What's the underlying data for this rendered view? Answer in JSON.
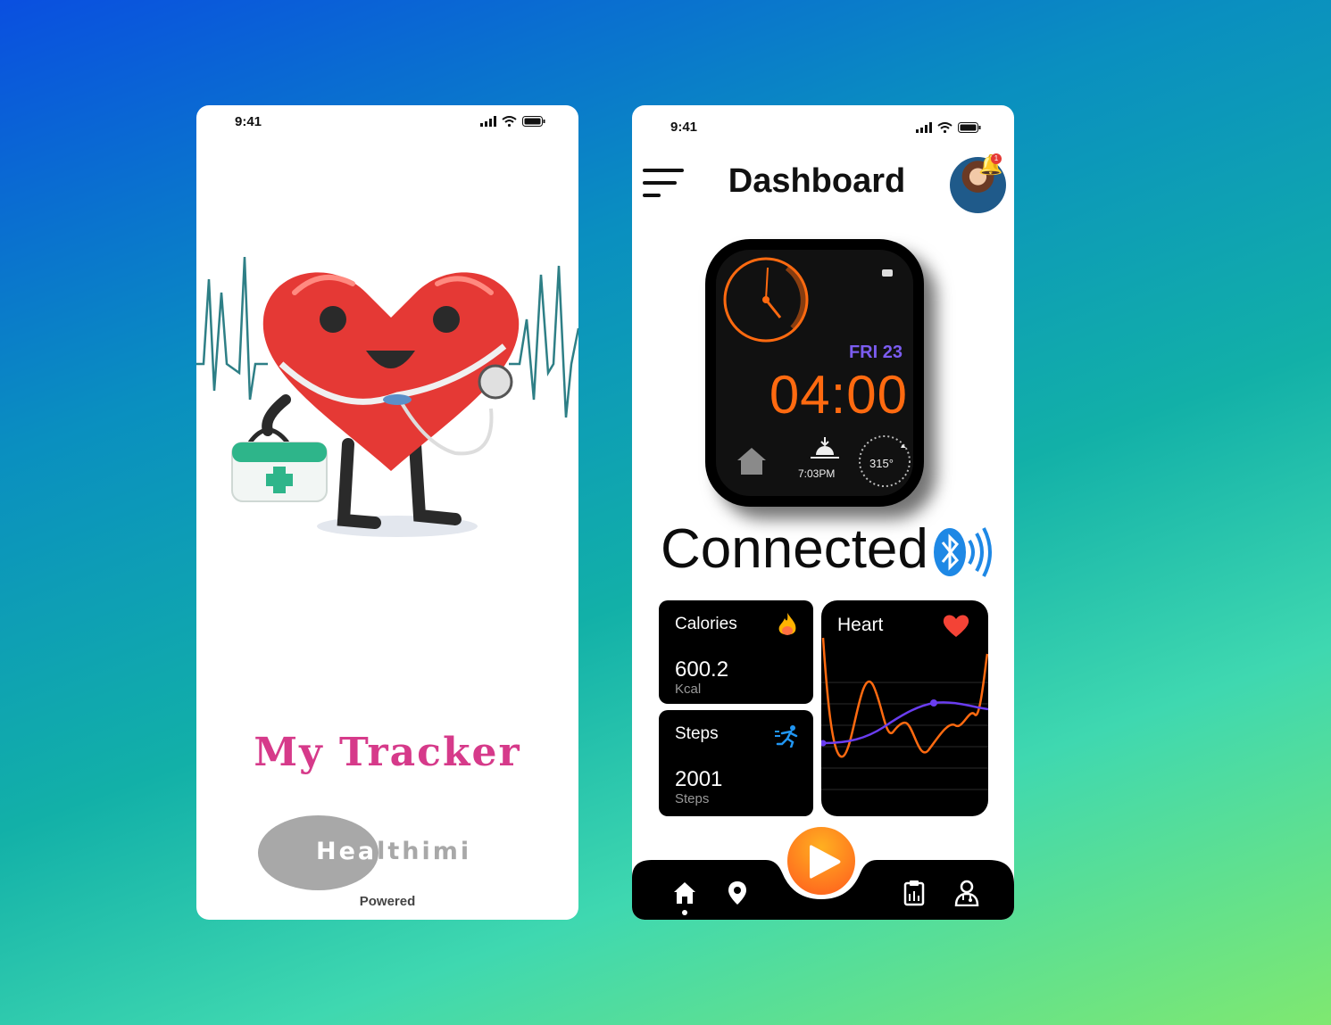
{
  "left_screen": {
    "status_time": "9:41",
    "brand_title": "My Tracker",
    "logo_text": "Healthimi",
    "powered_label": "Powered"
  },
  "right_screen": {
    "status_time": "9:41",
    "title": "Dashboard",
    "notification_count": "1",
    "watch": {
      "date": "FRI 23",
      "time": "04:00",
      "sunset_time": "7:03PM",
      "compass_heading": "315°"
    },
    "connection_status": "Connected",
    "cards": {
      "calories": {
        "label": "Calories",
        "value": "600.2",
        "unit": "Kcal",
        "icon": "fire-icon"
      },
      "steps": {
        "label": "Steps",
        "value": "2001",
        "unit": "Steps",
        "icon": "running-icon"
      },
      "heart": {
        "label": "Heart",
        "icon": "heart-icon"
      }
    },
    "bottom_nav": {
      "items": [
        "home-icon",
        "location-icon",
        "clipboard-icon",
        "doctor-icon"
      ],
      "active": "home"
    }
  },
  "colors": {
    "accent_orange": "#ff6a10",
    "accent_purple": "#7b5cf0",
    "brand_pink": "#d63a8a",
    "bluetooth_blue": "#1e88e5"
  }
}
